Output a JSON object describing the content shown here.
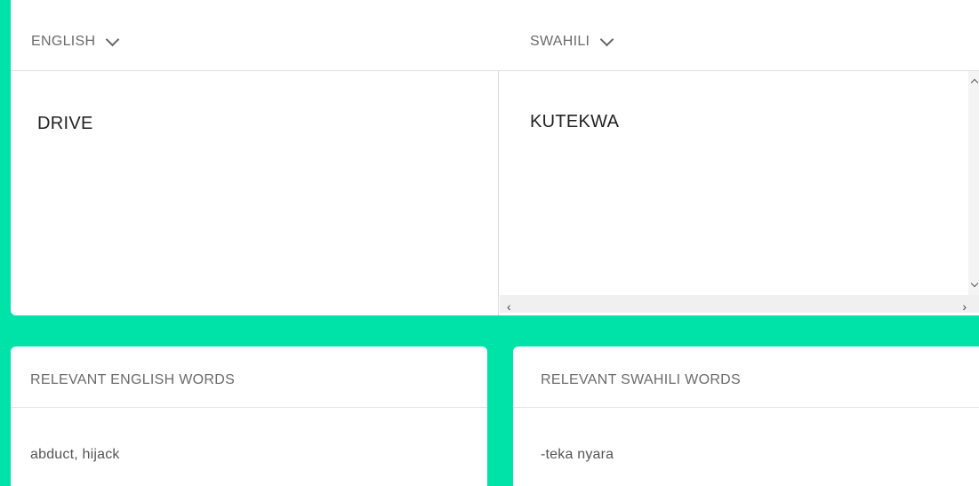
{
  "translator": {
    "source_language": "ENGLISH",
    "target_language": "SWAHILI",
    "source_text": "DRIVE",
    "target_text": "KUTEKWA"
  },
  "relevant": {
    "english": {
      "title": "RELEVANT ENGLISH WORDS",
      "words": "abduct, hijack"
    },
    "swahili": {
      "title": "RELEVANT SWAHILI WORDS",
      "words": "-teka nyara"
    }
  },
  "scrollbar": {
    "left_arrow": "‹",
    "right_arrow": "›"
  },
  "colors": {
    "accent": "#00e3a8",
    "card": "#ffffff",
    "label": "#6b6b6b"
  },
  "icons": [
    "chevron-down-icon",
    "scroll-left-icon",
    "scroll-right-icon",
    "scroll-up-icon",
    "scroll-down-icon"
  ]
}
